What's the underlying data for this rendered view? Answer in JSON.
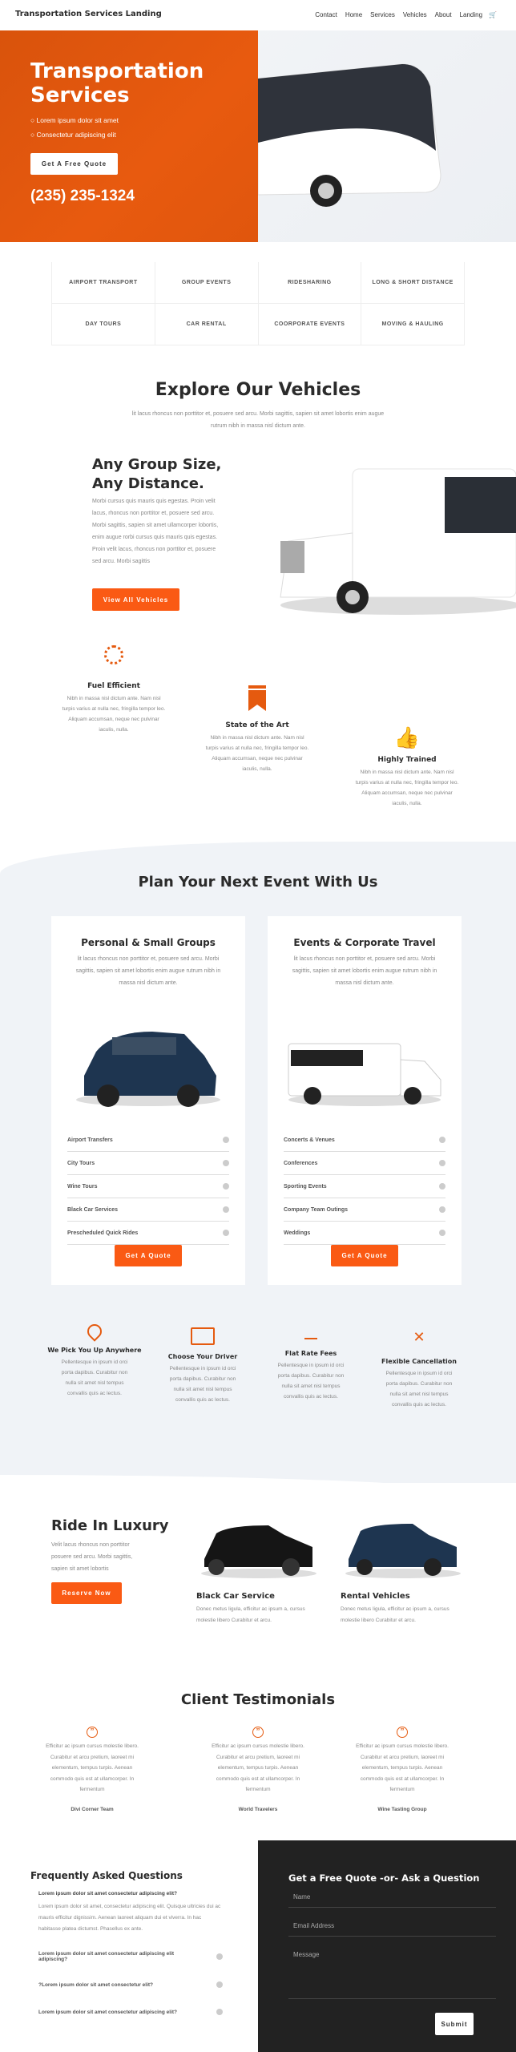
{
  "nav": {
    "site_title": "Transportation Services Landing",
    "items": [
      "Contact",
      "Home",
      "Services",
      "Vehicles",
      "About",
      "Landing"
    ],
    "cart_icon": "cart-icon"
  },
  "hero": {
    "title_1": "Transportation",
    "title_2": "Services",
    "bullets": [
      "Lorem ipsum dolor sit amet",
      "Consectetur adipiscing elit"
    ],
    "cta": "Get A Free Quote",
    "phone": "(235) 235-1324",
    "accent": "#e55a0f"
  },
  "services": [
    "AIRPORT TRANSPORT",
    "GROUP EVENTS",
    "RIDESHARING",
    "LONG & SHORT DISTANCE",
    "DAY TOURS",
    "CAR RENTAL",
    "COORPORATE EVENTS",
    "MOVING & HAULING"
  ],
  "explore": {
    "title": "Explore Our Vehicles",
    "subtitle": "lit lacus rhoncus non porttitor et, posuere sed arcu. Morbi sagittis, sapien sit amet lobortis enim augue rutrum nibh in massa nisl dictum ante.",
    "heading_1": "Any Group Size,",
    "heading_2": "Any Distance.",
    "body": "Morbi cursus quis mauris quis egestas. Proin velit lacus, rhoncus non porttitor et, posuere sed arcu. Morbi sagittis, sapien sit amet ullamcorper lobortis, enim augue rorbi cursus quis mauris quis egestas. Proin velit lacus, rhoncus non porttitor et, posuere sed arcu. Morbi sagittis",
    "button": "View All Vehicles"
  },
  "features": [
    {
      "title": "Fuel Efficient",
      "text": "Nibh in massa nisl dictum ante. Nam nisl turpis varius at nulla nec, fringilla tempor leo. Aliquam accumsan, neque nec pulvinar iaculis, nulla.",
      "icon": "loading-icon"
    },
    {
      "title": "State of the Art",
      "text": "Nibh in massa nisl dictum ante. Nam nisl turpis varius at nulla nec, fringilla tempor leo. Aliquam accumsan, neque nec pulvinar iaculis, nulla.",
      "icon": "bookmark-icon"
    },
    {
      "title": "Highly Trained",
      "text": "Nibh in massa nisl dictum ante. Nam nisl turpis varius at nulla nec, fringilla tempor leo. Aliquam accumsan, neque nec pulvinar iaculis, nulla.",
      "icon": "thumbs-up-icon"
    }
  ],
  "plan": {
    "title": "Plan Your Next Event With Us",
    "cards": [
      {
        "title": "Personal & Small Groups",
        "text": "lit lacus rhoncus non porttitor et, posuere sed arcu. Morbi sagittis, sapien sit amet lobortis enim augue rutrum nibh in massa nisl dictum ante.",
        "items": [
          "Airport Transfers",
          "City Tours",
          "Wine Tours",
          "Black Car Services",
          "Prescheduled Quick Rides"
        ],
        "button": "Get A Quote"
      },
      {
        "title": "Events & Corporate Travel",
        "text": "lit lacus rhoncus non porttitor et, posuere sed arcu. Morbi sagittis, sapien sit amet lobortis enim augue rutrum nibh in massa nisl dictum ante.",
        "items": [
          "Concerts & Venues",
          "Conferences",
          "Sporting Events",
          "Company Team Outings",
          "Weddings"
        ],
        "button": "Get A Quote"
      }
    ]
  },
  "perks": [
    {
      "title": "We Pick You Up Anywhere",
      "text": "Pellentesque in ipsum id orci porta dapibus. Curabitur non nulla sit amet nisl tempus convallis quis ac lectus.",
      "icon": "map-pin-icon"
    },
    {
      "title": "Choose Your Driver",
      "text": "Pellentesque in ipsum id orci porta dapibus. Curabitur non nulla sit amet nisl tempus convallis quis ac lectus.",
      "icon": "id-card-icon"
    },
    {
      "title": "Flat Rate Fees",
      "text": "Pellentesque in ipsum id orci porta dapibus. Curabitur non nulla sit amet nisl tempus convallis quis ac lectus.",
      "icon": "minus-icon"
    },
    {
      "title": "Flexible Cancellation",
      "text": "Pellentesque in ipsum id orci porta dapibus. Curabitur non nulla sit amet nisl tempus convallis quis ac lectus.",
      "icon": "close-icon"
    }
  ],
  "luxury": {
    "title": "Ride In Luxury",
    "text": "Velit lacus rhoncus non porttitor posuere sed arcu. Morbi sagittis, sapien sit amet lobortis",
    "button": "Reserve Now",
    "cards": [
      {
        "title": "Black Car Service",
        "text": "Donec metus ligula, efficitur ac ipsum a, cursus molestie libero Curabitur et arcu."
      },
      {
        "title": "Rental Vehicles",
        "text": "Donec metus ligula, efficitur ac ipsum a, cursus molestie libero Curabitur et arcu."
      }
    ]
  },
  "testimonials": {
    "title": "Client Testimonials",
    "items": [
      {
        "text": "Efficitur ac ipsum cursus molestie libero. Curabitur et arcu pretium, laoreet mi elementum, tempus turpis. Aenean commodo quis est at ullamcorper. In fermentum",
        "name": "Divi Corner Team"
      },
      {
        "text": "Efficitur ac ipsum cursus molestie libero. Curabitur et arcu pretium, laoreet mi elementum, tempus turpis. Aenean commodo quis est at ullamcorper. In fermentum",
        "name": "World Travelers"
      },
      {
        "text": "Efficitur ac ipsum cursus molestie libero. Curabitur et arcu pretium, laoreet mi elementum, tempus turpis. Aenean commodo quis est at ullamcorper. In fermentum",
        "name": "Wine Tasting Group"
      }
    ]
  },
  "faq": {
    "title": "Frequently Asked Questions",
    "open_q": "Lorem ipsum dolor sit amet consectetur adipiscing elit?",
    "open_a": "Lorem ipsum dolor sit amet, consectetur adipiscing elit. Quisque ultricies dui ac mauris efficitur dignissim. Aenean laoreet aliquam dui et viverra. In hac habitasse platea dictumst. Phasellus ex ante.",
    "questions": [
      "Lorem ipsum dolor sit amet consectetur adipiscing elit adipiscing?",
      "?Lorem ipsum dolor sit amet consectetur elit?",
      "Lorem ipsum dolor sit amet consectetur adipiscing elit?"
    ]
  },
  "form": {
    "title": "Get a Free Quote -or- Ask a Question",
    "name": "Name",
    "email": "Email Address",
    "message": "Message",
    "submit": "Submit"
  }
}
